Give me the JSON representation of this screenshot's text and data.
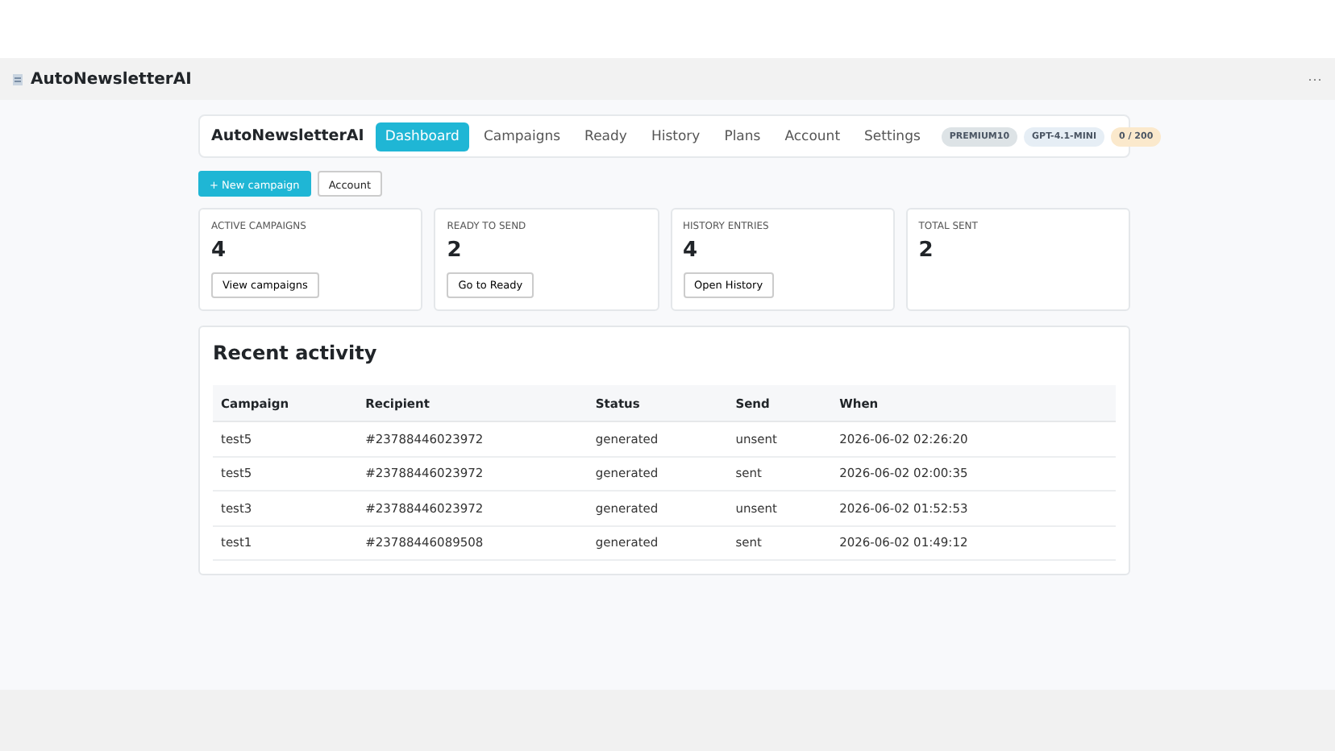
{
  "window": {
    "title": "AutoNewsletterAI",
    "menu_icon": "···"
  },
  "navbar": {
    "brand": "AutoNewsletterAI",
    "tabs": [
      {
        "label": "Dashboard",
        "selected": true
      },
      {
        "label": "Campaigns",
        "selected": false
      },
      {
        "label": "Ready",
        "selected": false
      },
      {
        "label": "History",
        "selected": false
      },
      {
        "label": "Plans",
        "selected": false
      },
      {
        "label": "Account",
        "selected": false
      },
      {
        "label": "Settings",
        "selected": false
      }
    ],
    "badges": [
      {
        "label": "PREMIUM10",
        "color": "#dde3e6"
      },
      {
        "label": "GPT-4.1-MINI",
        "color": "#e6eef5"
      },
      {
        "label": "0 / 200",
        "color": "#fbe9cc"
      }
    ]
  },
  "actions": [
    {
      "label": "+ New campaign",
      "kind": "primary"
    },
    {
      "label": "Account",
      "kind": "secondary"
    }
  ],
  "stats": [
    {
      "label": "ACTIVE CAMPAIGNS",
      "value": "4",
      "button": "View campaigns"
    },
    {
      "label": "READY TO SEND",
      "value": "2",
      "button": "Go to Ready"
    },
    {
      "label": "HISTORY ENTRIES",
      "value": "4",
      "button": "Open History"
    },
    {
      "label": "TOTAL SENT",
      "value": "2"
    }
  ],
  "recent_activity": {
    "title": "Recent activity",
    "columns": [
      "Campaign",
      "Recipient",
      "Status",
      "Send",
      "When"
    ],
    "rows": [
      [
        "test5",
        "#23788446023972",
        "generated",
        "unsent",
        "2026-06-02 02:26:20"
      ],
      [
        "test5",
        "#23788446023972",
        "generated",
        "sent",
        "2026-06-02 02:00:35"
      ],
      [
        "test3",
        "#23788446023972",
        "generated",
        "unsent",
        "2026-06-02 01:52:53"
      ],
      [
        "test1",
        "#23788446089508",
        "generated",
        "sent",
        "2026-06-02 01:49:12"
      ]
    ]
  }
}
